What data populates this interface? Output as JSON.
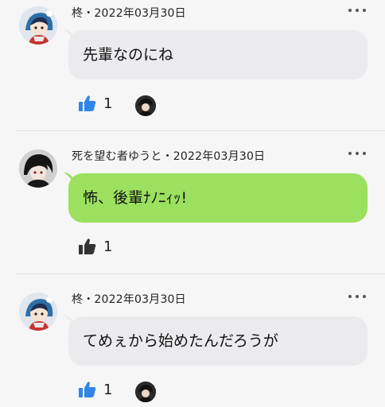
{
  "comments": [
    {
      "author": "柊",
      "date": "2022年03月30日",
      "meta": "柊・2022年03月30日",
      "text": "先輩なのにね",
      "likes": "1",
      "bubble_color": "#ebebee",
      "liked": true,
      "avatar_icon": "anime-avatar-blue-hood-icon",
      "reactor_icon": "dark-avatar-icon"
    },
    {
      "author": "死を望む者ゆうと",
      "date": "2022年03月30日",
      "meta": "死を望む者ゆうと・2022年03月30日",
      "text": "怖、後輩ﾅﾉﾆｨｯ!",
      "likes": "1",
      "bubble_color": "#9be05f",
      "liked": false,
      "avatar_icon": "dark-anime-avatar-icon"
    },
    {
      "author": "柊",
      "date": "2022年03月30日",
      "meta": "柊・2022年03月30日",
      "text": "てめぇから始めたんだろうが",
      "likes": "1",
      "bubble_color": "#ebebee",
      "liked": true,
      "avatar_icon": "anime-avatar-blue-hood-icon",
      "reactor_icon": "dark-avatar-icon"
    }
  ],
  "colors": {
    "like_active": "#2f86e6",
    "like_inactive": "#333333",
    "background": "#f6f6f7"
  },
  "icons": {
    "more": "more-options-icon",
    "like": "thumbs-up-icon"
  }
}
